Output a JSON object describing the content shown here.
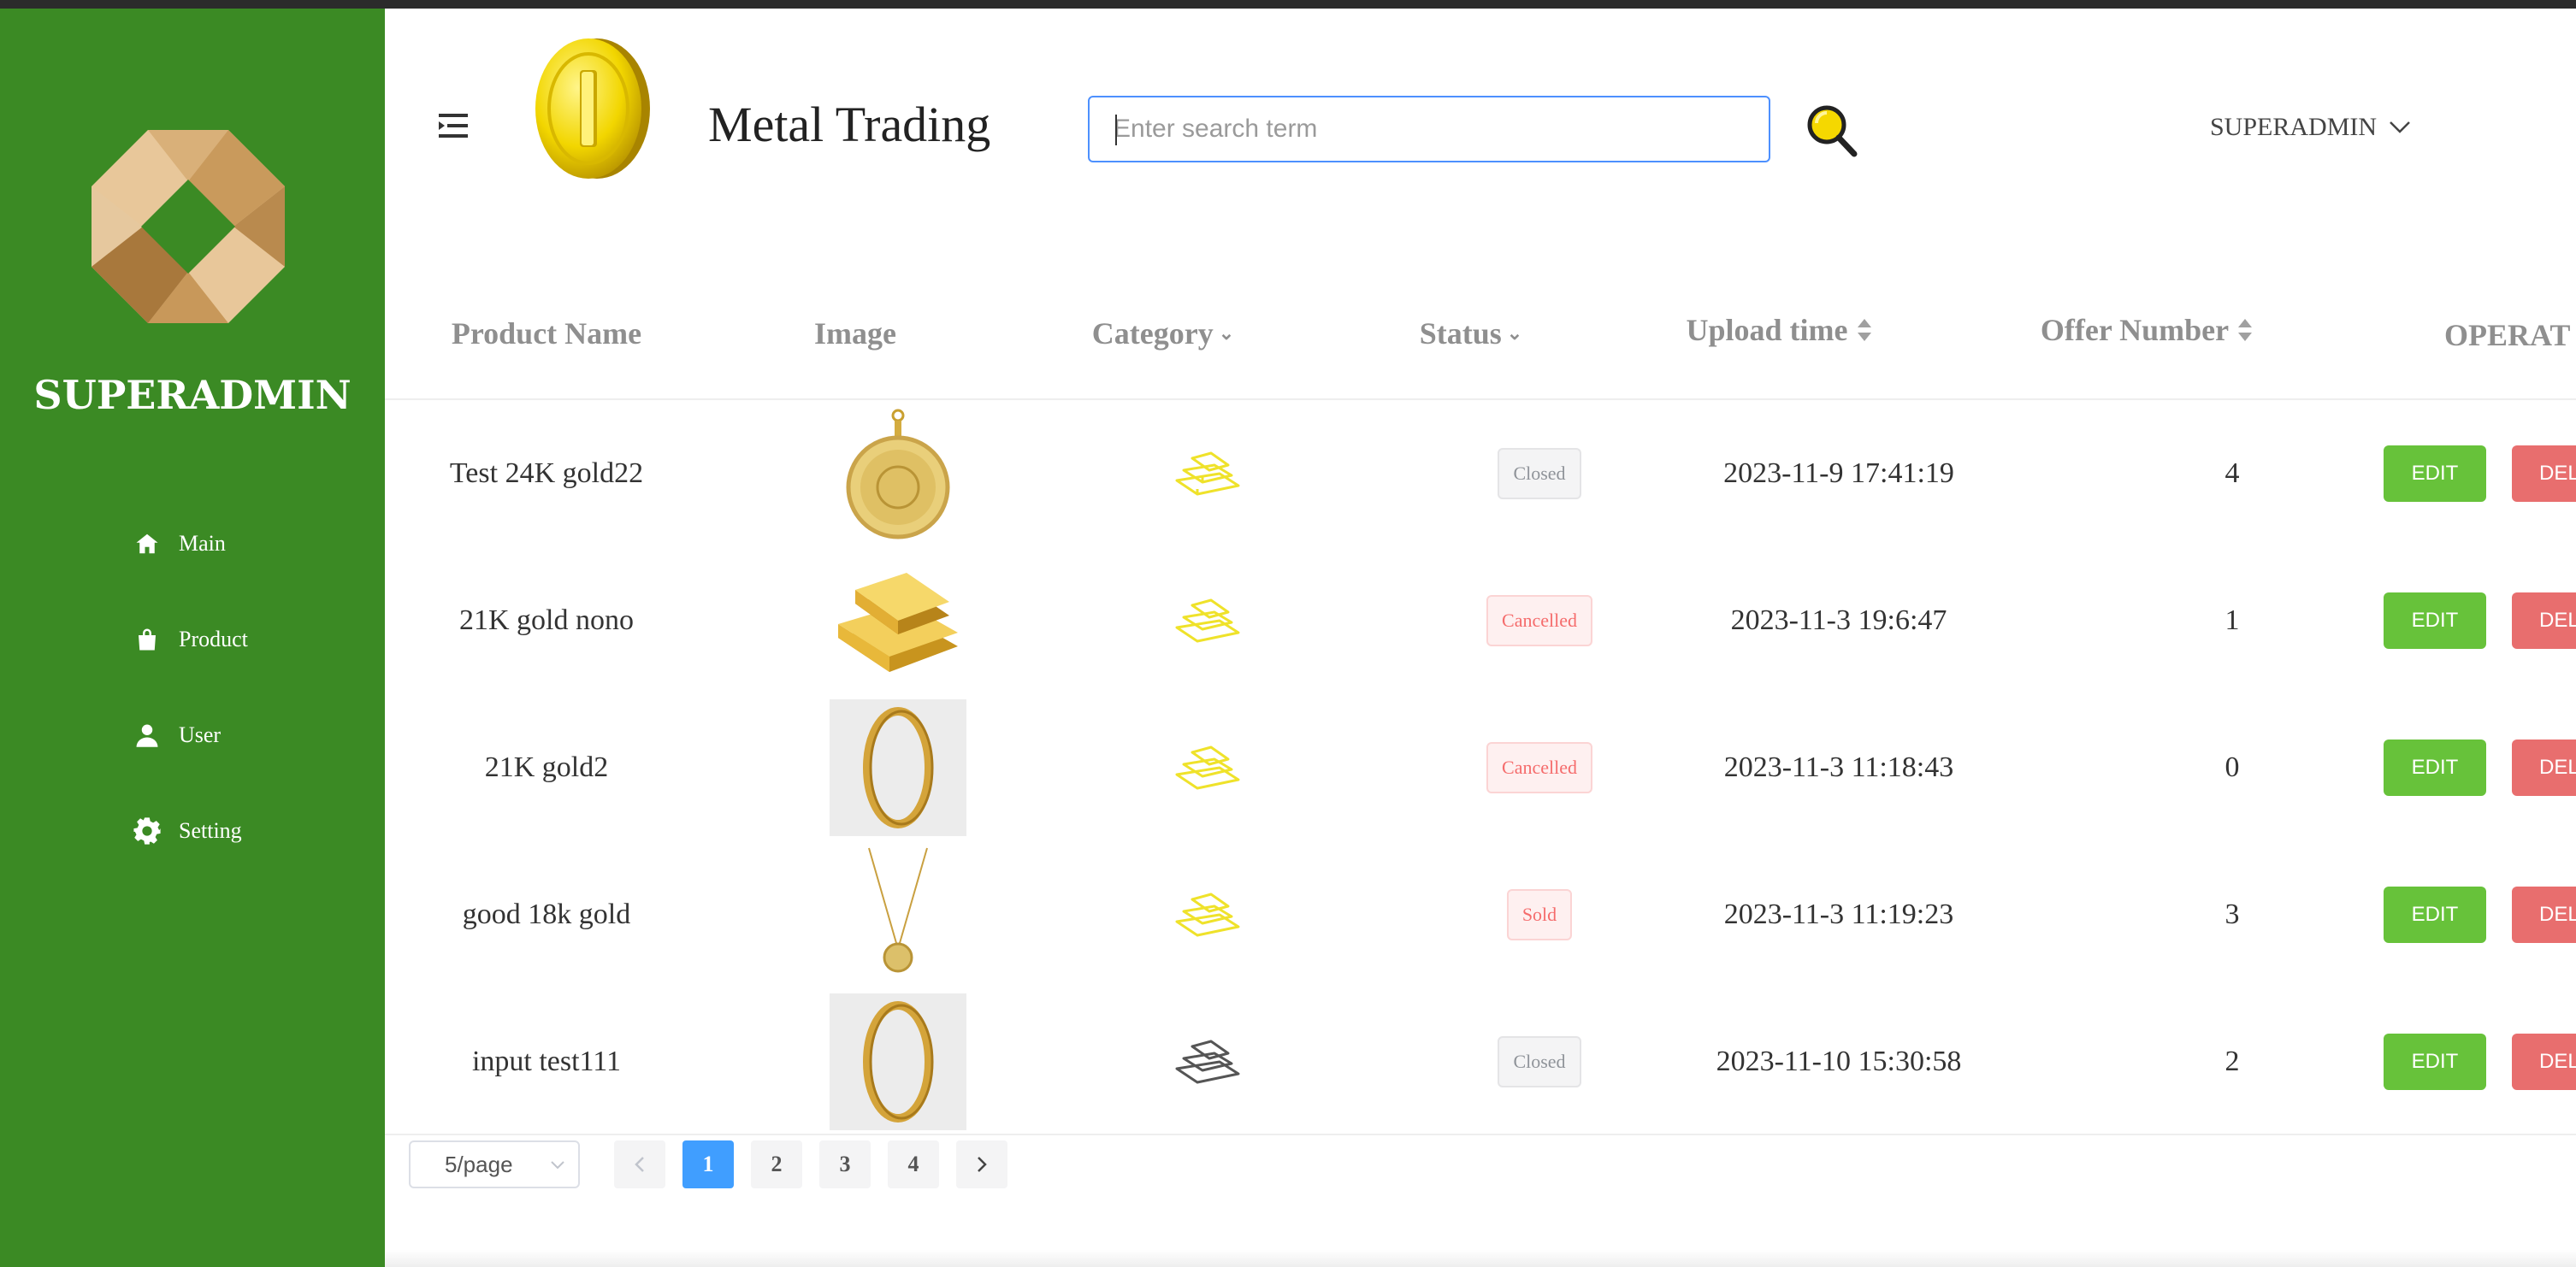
{
  "sidebar": {
    "title": "SUPERADMIN",
    "items": [
      {
        "label": "Main",
        "icon": "home-icon"
      },
      {
        "label": "Product",
        "icon": "shopping-bag-icon"
      },
      {
        "label": "User",
        "icon": "user-icon"
      },
      {
        "label": "Setting",
        "icon": "gear-icon"
      }
    ]
  },
  "header": {
    "app_title": "Metal Trading",
    "search_placeholder": "Enter search term",
    "search_value": "",
    "user_label": "SUPERADMIN"
  },
  "table": {
    "columns": [
      "Product Name",
      "Image",
      "Category",
      "Status",
      "Upload time",
      "Offer Number",
      "OPERAT"
    ],
    "rows": [
      {
        "name": "Test 24K gold22",
        "image": "gold-coin-pendant",
        "category": "gold",
        "status": "Closed",
        "upload_time": "2023-11-9 17:41:19",
        "offers": "4"
      },
      {
        "name": "21K gold nono",
        "image": "gold-bars",
        "category": "gold",
        "status": "Cancelled",
        "upload_time": "2023-11-3 19:6:47",
        "offers": "1"
      },
      {
        "name": "21K gold2",
        "image": "gold-ring",
        "category": "gold",
        "status": "Cancelled",
        "upload_time": "2023-11-3 11:18:43",
        "offers": "0"
      },
      {
        "name": "good 18k gold",
        "image": "gold-necklace",
        "category": "gold",
        "status": "Sold",
        "upload_time": "2023-11-3 11:19:23",
        "offers": "3"
      },
      {
        "name": "input test111",
        "image": "gold-ring",
        "category": "silver",
        "status": "Closed",
        "upload_time": "2023-11-10 15:30:58",
        "offers": "2"
      }
    ],
    "edit_label": "EDIT",
    "delete_label": "DEL"
  },
  "pagination": {
    "page_size": "5/page",
    "pages": [
      "1",
      "2",
      "3",
      "4"
    ],
    "current": "1"
  },
  "colors": {
    "sidebar": "#3b8a24",
    "edit": "#67c23a",
    "delete": "#e86e6e",
    "primary": "#409eff",
    "gold_icon": "#f0e020"
  }
}
